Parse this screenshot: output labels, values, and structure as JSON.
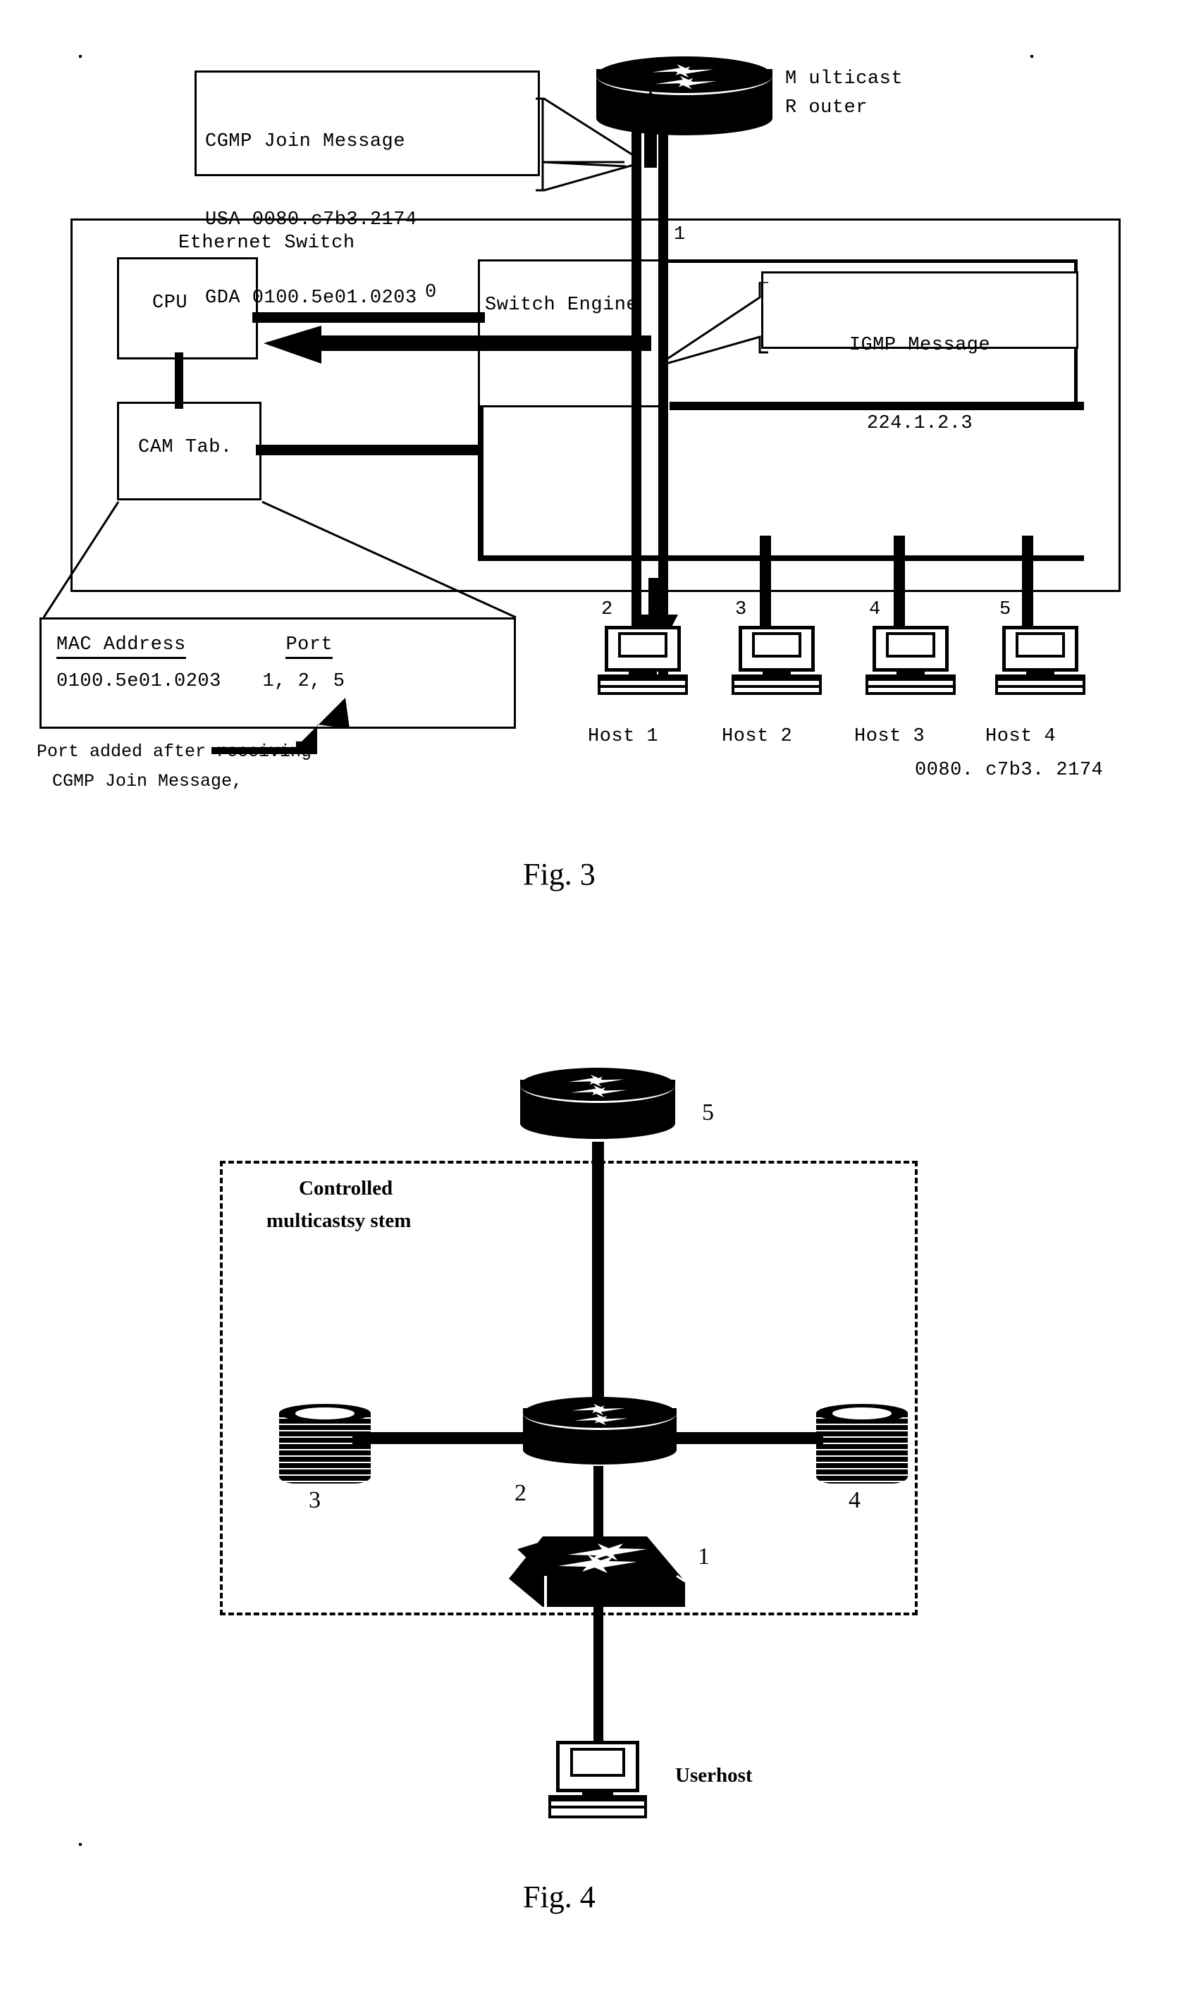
{
  "figure3": {
    "caption": "Fig. 3",
    "cgmp_callout": {
      "line1": "CGMP Join Message",
      "line2": "USA 0080.c7b3.2174",
      "line3": "GDA 0100.5e01.0203"
    },
    "router_label": {
      "line1": "M ulticast",
      "line2": "R outer"
    },
    "switch_title": "Ethernet Switch",
    "cpu_label": "CPU",
    "cam_label": "CAM Tab.",
    "switch_engine_label": "Switch Engine",
    "igmp_callout": {
      "line1": "IGMP Message",
      "line2": "224.1.2.3"
    },
    "port_cpu": "0",
    "port_uplink": "1",
    "cam_detail": {
      "header_mac": "MAC Address",
      "header_port": "Port",
      "row_mac": "0100.5e01.0203",
      "row_port": "1, 2, 5"
    },
    "annotation": {
      "line1": "Port added after receiving",
      "line2": "CGMP Join Message,"
    },
    "hosts": [
      {
        "port": "2",
        "name": "Host 1",
        "mac": ""
      },
      {
        "port": "3",
        "name": "Host 2",
        "mac": ""
      },
      {
        "port": "4",
        "name": "Host 3",
        "mac": ""
      },
      {
        "port": "5",
        "name": "Host 4",
        "mac": "0080. c7b3. 2174"
      }
    ]
  },
  "figure4": {
    "caption": "Fig. 4",
    "system_label": {
      "line1": "Controlled",
      "line2": "multicastsy stem"
    },
    "nodes": {
      "top_router": "5",
      "center_router": "2",
      "left_drum": "3",
      "right_drum": "4",
      "lan_switch": "1"
    },
    "userhost_label": "Userhost"
  },
  "colors": {
    "ink": "#000000",
    "paper": "#ffffff"
  }
}
